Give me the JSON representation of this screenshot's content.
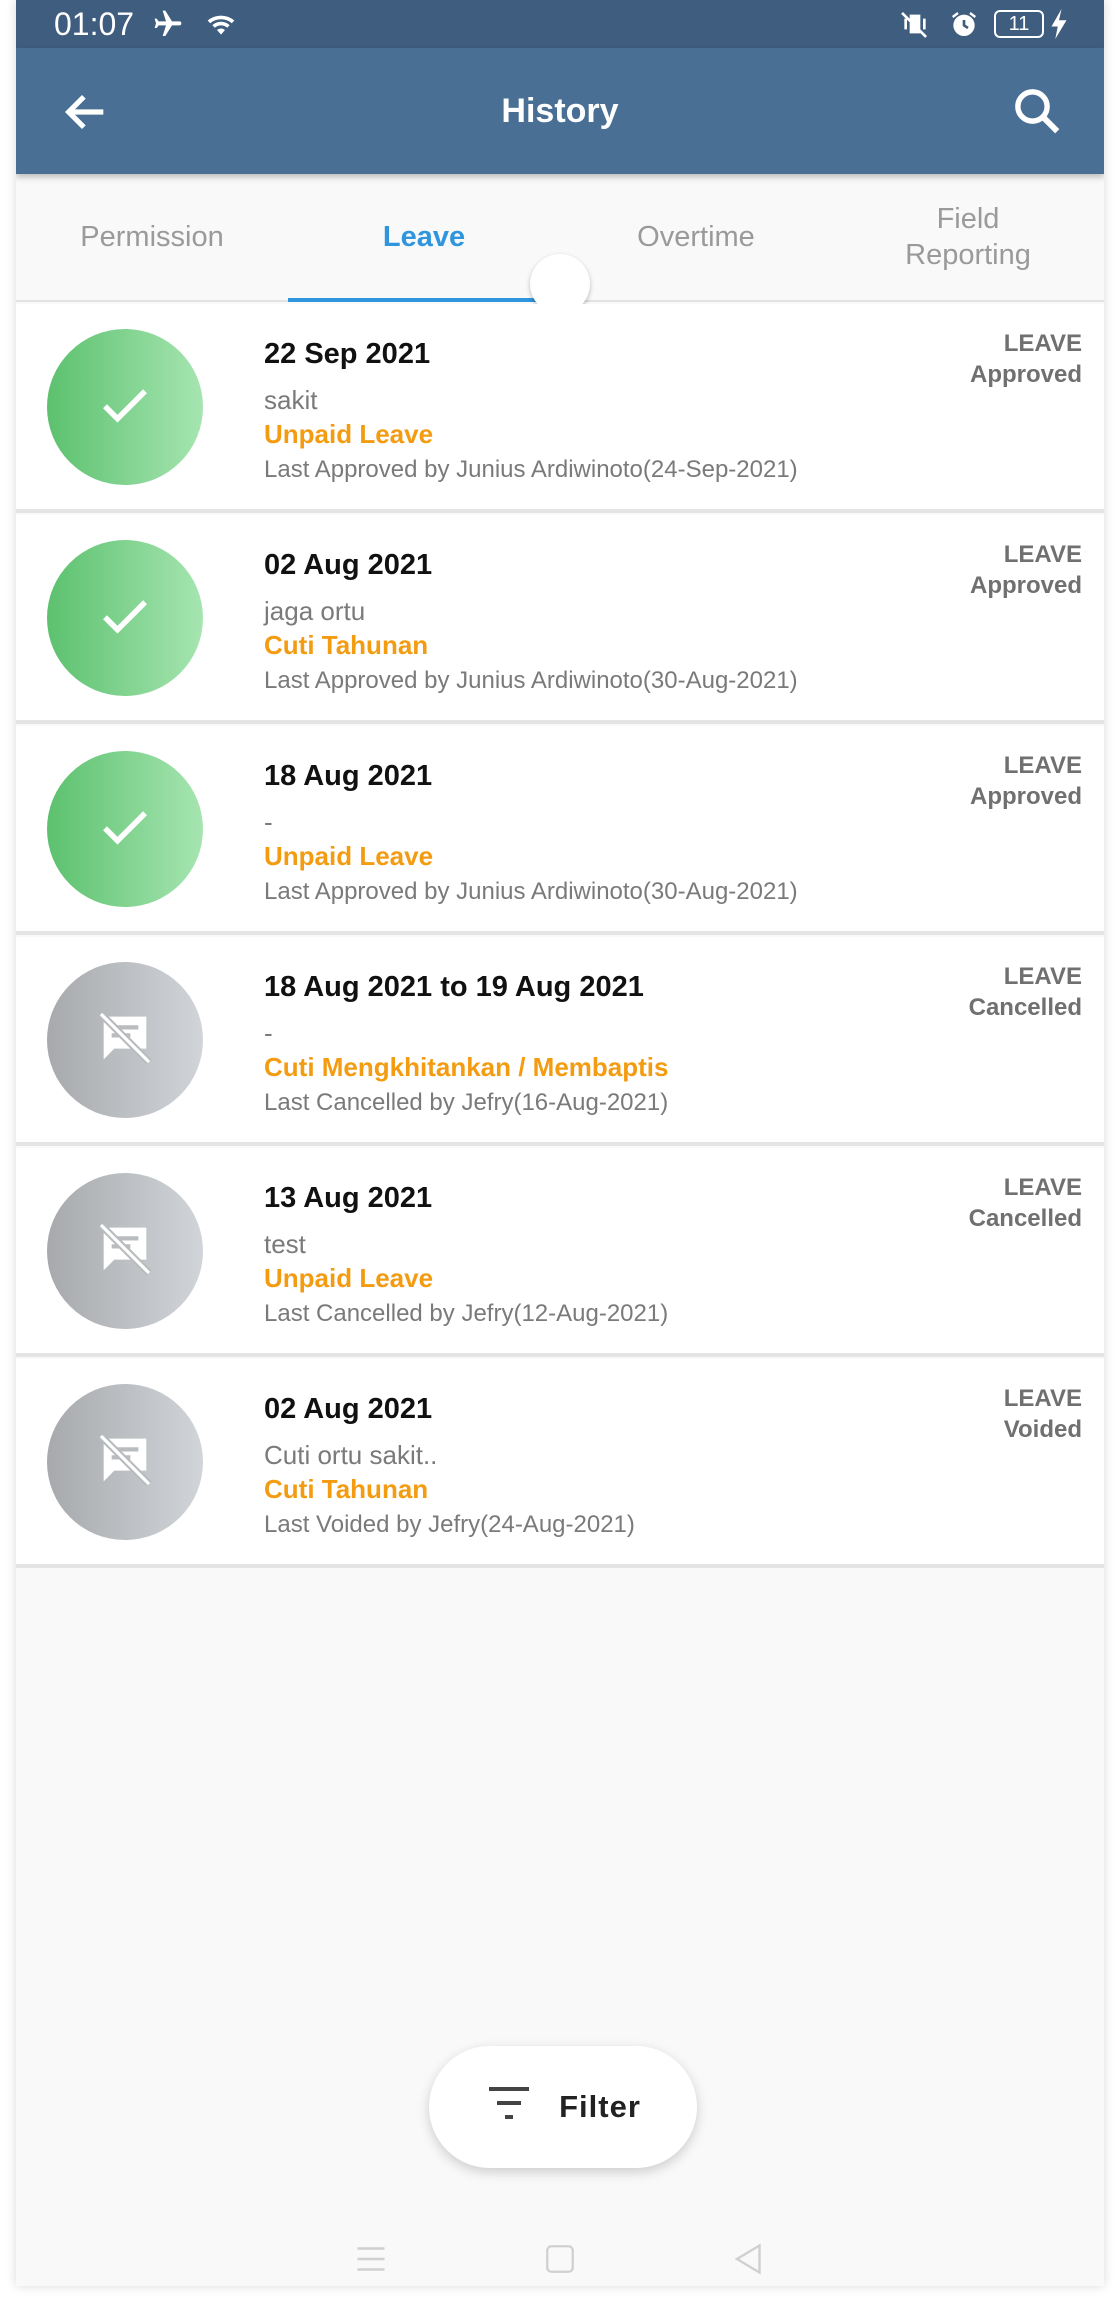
{
  "status_bar": {
    "time": "01:07",
    "battery": "11"
  },
  "app_bar": {
    "title": "History"
  },
  "tabs": [
    {
      "label": "Permission",
      "active": false
    },
    {
      "label": "Leave",
      "active": true
    },
    {
      "label": "Overtime",
      "active": false
    },
    {
      "label": "Field\nReporting",
      "active": false
    }
  ],
  "items": [
    {
      "date": "22 Sep 2021",
      "reason": "sakit",
      "type": "Unpaid Leave",
      "last_action": "Last Approved by Junius Ardiwinoto(24-Sep-2021)",
      "category": "LEAVE",
      "status": "Approved",
      "icon": "check-icon"
    },
    {
      "date": "02 Aug 2021",
      "reason": "jaga ortu",
      "type": "Cuti Tahunan",
      "last_action": "Last Approved by Junius Ardiwinoto(30-Aug-2021)",
      "category": "LEAVE",
      "status": "Approved",
      "icon": "check-icon"
    },
    {
      "date": "18 Aug 2021",
      "reason": "-",
      "type": "Unpaid Leave",
      "last_action": "Last Approved by Junius Ardiwinoto(30-Aug-2021)",
      "category": "LEAVE",
      "status": "Approved",
      "icon": "check-icon"
    },
    {
      "date": "18 Aug 2021 to 19 Aug 2021",
      "reason": "-",
      "type": "Cuti Mengkhitankan / Membaptis",
      "last_action": "Last Cancelled by Jefry(16-Aug-2021)",
      "category": "LEAVE",
      "status": "Cancelled",
      "icon": "comment-off-icon"
    },
    {
      "date": "13 Aug 2021",
      "reason": "test",
      "type": "Unpaid Leave",
      "last_action": "Last Cancelled by Jefry(12-Aug-2021)",
      "category": "LEAVE",
      "status": "Cancelled",
      "icon": "comment-off-icon"
    },
    {
      "date": "02 Aug 2021",
      "reason": "Cuti ortu sakit..",
      "type": "Cuti Tahunan",
      "last_action": "Last Voided by Jefry(24-Aug-2021)",
      "category": "LEAVE",
      "status": "Voided",
      "icon": "comment-off-icon"
    }
  ],
  "filter": {
    "label": "Filter"
  },
  "colors": {
    "status_bar": "#3f5d7e",
    "app_bar": "#4a6f95",
    "active_tab": "#2f95dc",
    "leave_type": "#f39c12",
    "approved_green": "#5cc16e",
    "cancelled_grey": "#a7a9ac"
  }
}
